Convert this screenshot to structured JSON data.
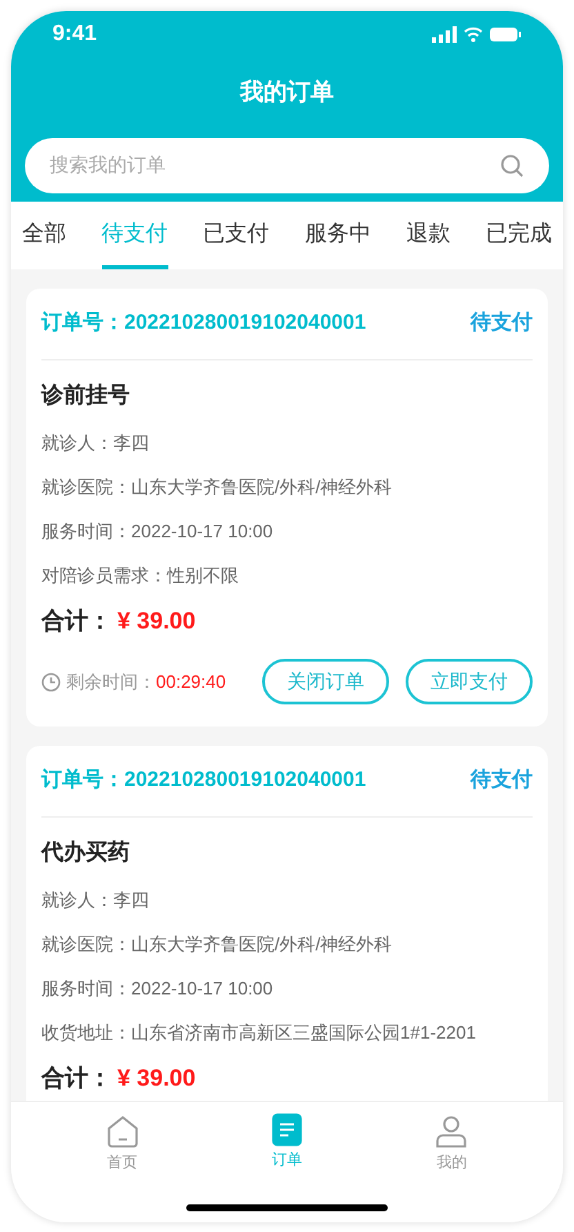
{
  "status_bar": {
    "time": "9:41"
  },
  "header": {
    "title": "我的订单"
  },
  "search": {
    "placeholder": "搜索我的订单"
  },
  "tabs": [
    {
      "label": "全部",
      "selected": false
    },
    {
      "label": "待支付",
      "selected": true
    },
    {
      "label": "已支付",
      "selected": false
    },
    {
      "label": "服务中",
      "selected": false
    },
    {
      "label": "退款",
      "selected": false
    },
    {
      "label": "已完成",
      "selected": false
    }
  ],
  "orders": [
    {
      "order_no": "订单号：202210280019102040001",
      "status": "待支付",
      "title": "诊前挂号",
      "fields": [
        "就诊人：李四",
        "就诊医院：山东大学齐鲁医院/外科/神经外科",
        "服务时间：2022-10-17 10:00",
        "对陪诊员需求：性别不限"
      ],
      "total_label": "合计：",
      "total": "¥ 39.00",
      "timer_label": "剩余时间：",
      "timer": "00:29:40",
      "actions": [
        "关闭订单",
        "立即支付"
      ]
    },
    {
      "order_no": "订单号：202210280019102040001",
      "status": "待支付",
      "title": "代办买药",
      "fields": [
        "就诊人：李四",
        "就诊医院：山东大学齐鲁医院/外科/神经外科",
        "服务时间：2022-10-17 10:00",
        "收货地址：山东省济南市高新区三盛国际公园1#1-2201"
      ],
      "total_label": "合计：",
      "total": "¥ 39.00"
    }
  ],
  "bottom_nav": [
    {
      "label": "首页",
      "kind": "home",
      "selected": false
    },
    {
      "label": "订单",
      "kind": "orders",
      "selected": true
    },
    {
      "label": "我的",
      "kind": "profile",
      "selected": false
    }
  ]
}
